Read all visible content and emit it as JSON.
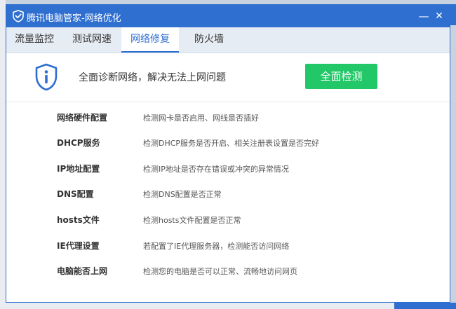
{
  "window": {
    "title": "腾讯电脑管家-网络优化",
    "minimize_glyph": "—",
    "close_glyph": "✕"
  },
  "tabs": [
    {
      "label": "流量监控",
      "active": false
    },
    {
      "label": "测试网速",
      "active": false
    },
    {
      "label": "网络修复",
      "active": true
    },
    {
      "label": "防火墙",
      "active": false
    }
  ],
  "hero": {
    "icon": "info-shield-icon",
    "text": "全面诊断网络，解决无法上网问题",
    "button_label": "全面检测"
  },
  "checks": [
    {
      "name": "网络硬件配置",
      "desc": "检测网卡是否启用、网线是否插好"
    },
    {
      "name": "DHCP服务",
      "desc": "检测DHCP服务是否开启、相关注册表设置是否完好"
    },
    {
      "name": "IP地址配置",
      "desc": "检测IP地址是否存在错误或冲突的异常情况"
    },
    {
      "name": "DNS配置",
      "desc": "检测DNS配置是否正常"
    },
    {
      "name": "hosts文件",
      "desc": "检测hosts文件配置是否正常"
    },
    {
      "name": "IE代理设置",
      "desc": "若配置了IE代理服务器，检测能否访问网络"
    },
    {
      "name": "电脑能否上网",
      "desc": "检测您的电脑是否可以正常、流畅地访问网页"
    }
  ],
  "colors": {
    "accent": "#2f6fd0",
    "button_green": "#22c767"
  }
}
